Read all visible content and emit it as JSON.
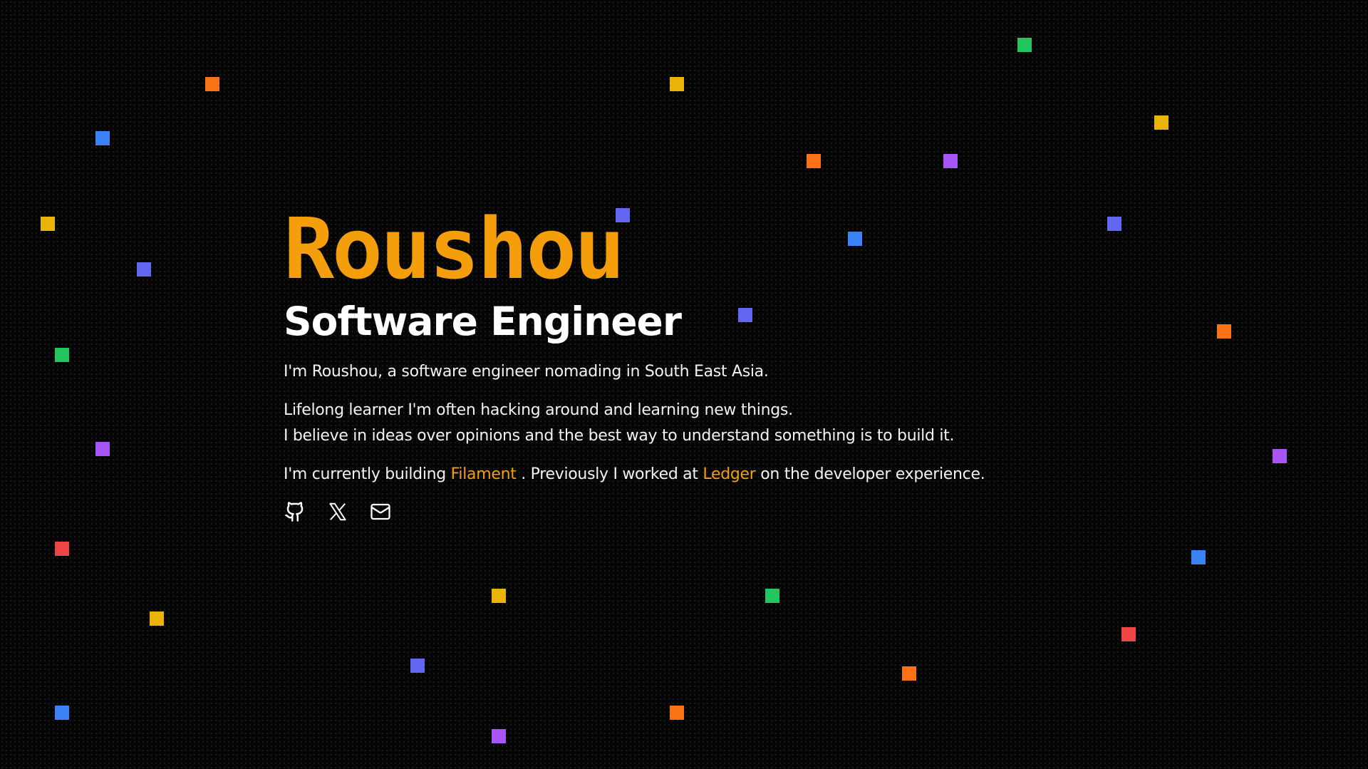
{
  "hero": {
    "name": "Roushou",
    "role": "Software Engineer"
  },
  "bio": {
    "intro": "I'm Roushou, a software engineer nomading in South East Asia.",
    "line2": "Lifelong learner I'm often hacking around and learning new things.",
    "line3": "I believe in ideas over opinions and the best way to understand something is to build it.",
    "building_prefix": "I'm currently building ",
    "building_link": "Filament",
    "building_middle": " . Previously I worked at ",
    "previous_link": "Ledger",
    "building_suffix": " on the developer experience."
  },
  "socials": [
    {
      "icon": "github-icon"
    },
    {
      "icon": "x-icon"
    },
    {
      "icon": "mail-icon"
    }
  ],
  "colors": {
    "background": "#050505",
    "accent": "#f59e0b",
    "text": "#f2f2f2",
    "confetti": [
      "#f97316",
      "#3b82f6",
      "#eab308",
      "#6366f1",
      "#22c55e",
      "#a855f7",
      "#ef4444"
    ]
  }
}
